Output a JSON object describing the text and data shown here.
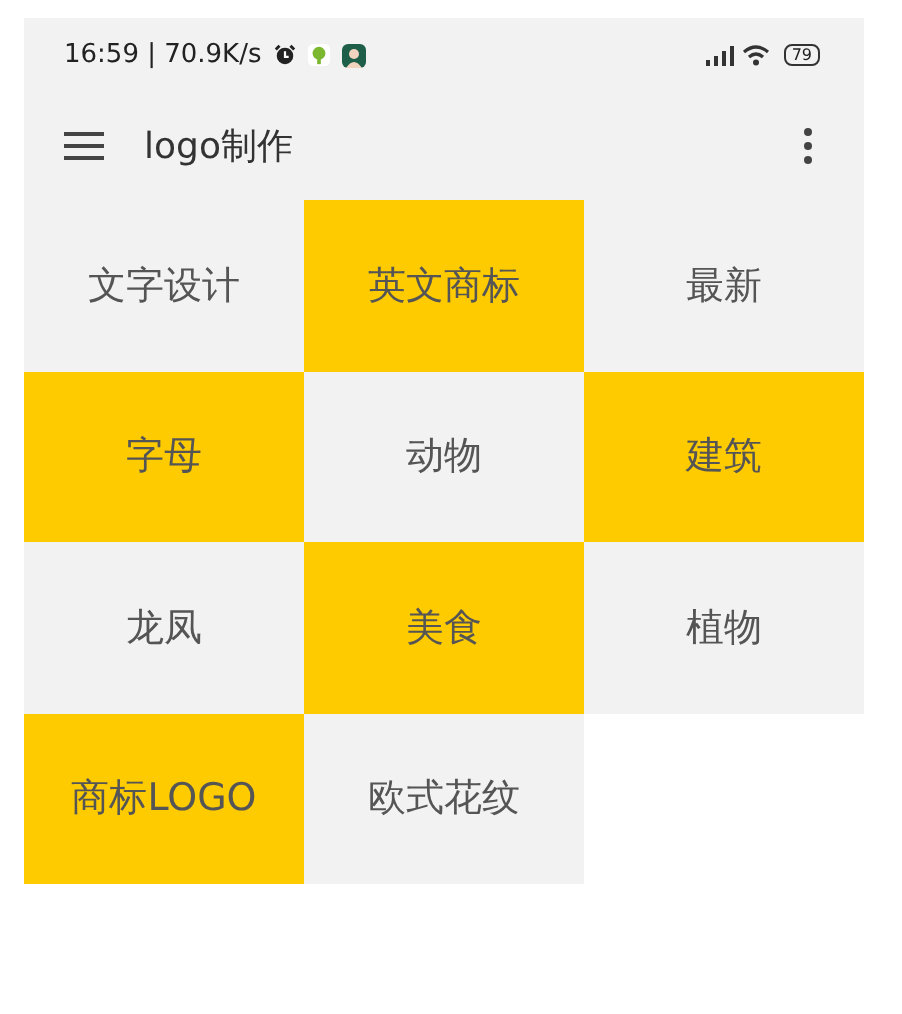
{
  "status_bar": {
    "time_and_speed": "16:59 | 70.9K/s",
    "battery": "79"
  },
  "toolbar": {
    "title": "logo制作"
  },
  "tiles": [
    {
      "label": "文字设计",
      "color": "#f2f2f2"
    },
    {
      "label": "英文商标",
      "color": "#fecb00"
    },
    {
      "label": "最新",
      "color": "#f2f2f2"
    },
    {
      "label": "字母",
      "color": "#fecb00"
    },
    {
      "label": "动物",
      "color": "#f2f2f2"
    },
    {
      "label": "建筑",
      "color": "#fecb00"
    },
    {
      "label": "龙凤",
      "color": "#f2f2f2"
    },
    {
      "label": "美食",
      "color": "#fecb00"
    },
    {
      "label": "植物",
      "color": "#f2f2f2"
    },
    {
      "label": "商标LOGO",
      "color": "#fecb00"
    },
    {
      "label": "欧式花纹",
      "color": "#f2f2f2"
    }
  ]
}
